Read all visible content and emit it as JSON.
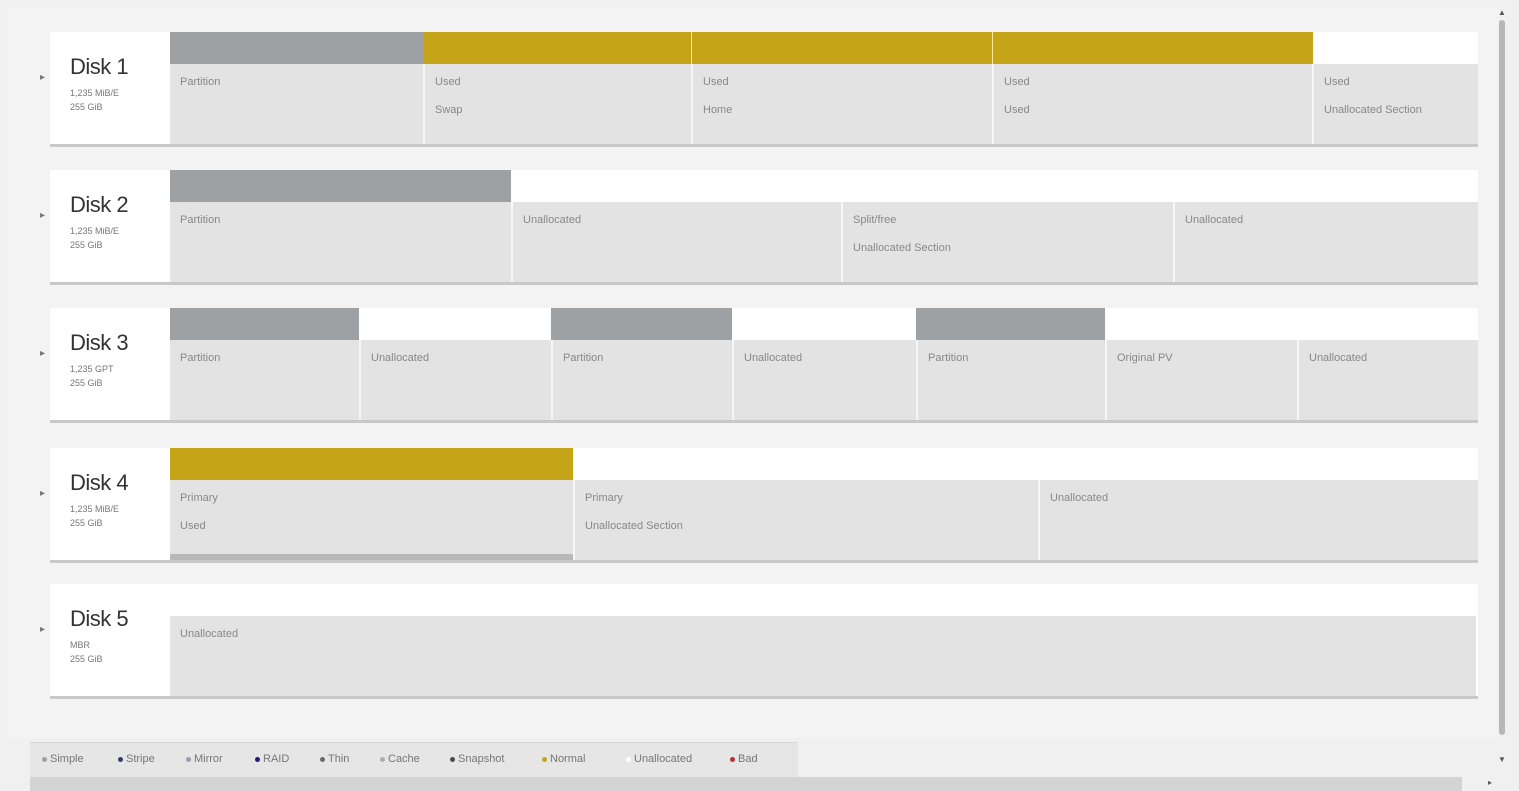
{
  "disks": [
    {
      "name": "Disk 1",
      "sub1": "1,235 MiB/E",
      "sub2": "255 GiB",
      "parts": [
        {
          "l1": "Partition",
          "l2": ""
        },
        {
          "l1": "Used",
          "l2": "Swap"
        },
        {
          "l1": "Used",
          "l2": "Home"
        },
        {
          "l1": "Used",
          "l2": "Used"
        },
        {
          "l1": "Used",
          "l2": "Unallocated Section"
        }
      ]
    },
    {
      "name": "Disk 2",
      "sub1": "1,235 MiB/E",
      "sub2": "255 GiB",
      "parts": [
        {
          "l1": "Partition",
          "l2": ""
        },
        {
          "l1": "Unallocated",
          "l2": ""
        },
        {
          "l1": "Split/free",
          "l2": "Unallocated Section"
        },
        {
          "l1": "Unallocated",
          "l2": ""
        }
      ]
    },
    {
      "name": "Disk 3",
      "sub1": "1,235 GPT",
      "sub2": "255 GiB",
      "parts": [
        {
          "l1": "Partition",
          "l2": ""
        },
        {
          "l1": "Unallocated",
          "l2": ""
        },
        {
          "l1": "Partition",
          "l2": ""
        },
        {
          "l1": "Unallocated",
          "l2": ""
        },
        {
          "l1": "Partition",
          "l2": ""
        },
        {
          "l1": "Original PV",
          "l2": ""
        },
        {
          "l1": "Unallocated",
          "l2": ""
        }
      ]
    },
    {
      "name": "Disk 4",
      "sub1": "1,235 MiB/E",
      "sub2": "255 GiB",
      "parts": [
        {
          "l1": "Primary",
          "l2": "Used"
        },
        {
          "l1": "Primary",
          "l2": "Unallocated Section"
        },
        {
          "l1": "Unallocated",
          "l2": ""
        }
      ]
    },
    {
      "name": "Disk 5",
      "sub1": "MBR",
      "sub2": "255 GiB",
      "parts": [
        {
          "l1": "Unallocated",
          "l2": ""
        }
      ]
    }
  ],
  "legend": [
    {
      "label": "Simple",
      "color": "#9da1a3"
    },
    {
      "label": "Stripe",
      "color": "#3b3b6b"
    },
    {
      "label": "Mirror",
      "color": "#8fa0b0"
    },
    {
      "label": "RAID",
      "color": "#1e1e6e"
    },
    {
      "label": "Thin",
      "color": "#6a6a6a"
    },
    {
      "label": "Cache",
      "color": "#a0b8a0"
    },
    {
      "label": "Snapshot",
      "color": "#4a4a4a"
    },
    {
      "label": "Normal",
      "color": "#c5a418"
    },
    {
      "label": "Unallocated",
      "color": "#ffffff"
    },
    {
      "label": "Bad",
      "color": "#b83030"
    }
  ]
}
